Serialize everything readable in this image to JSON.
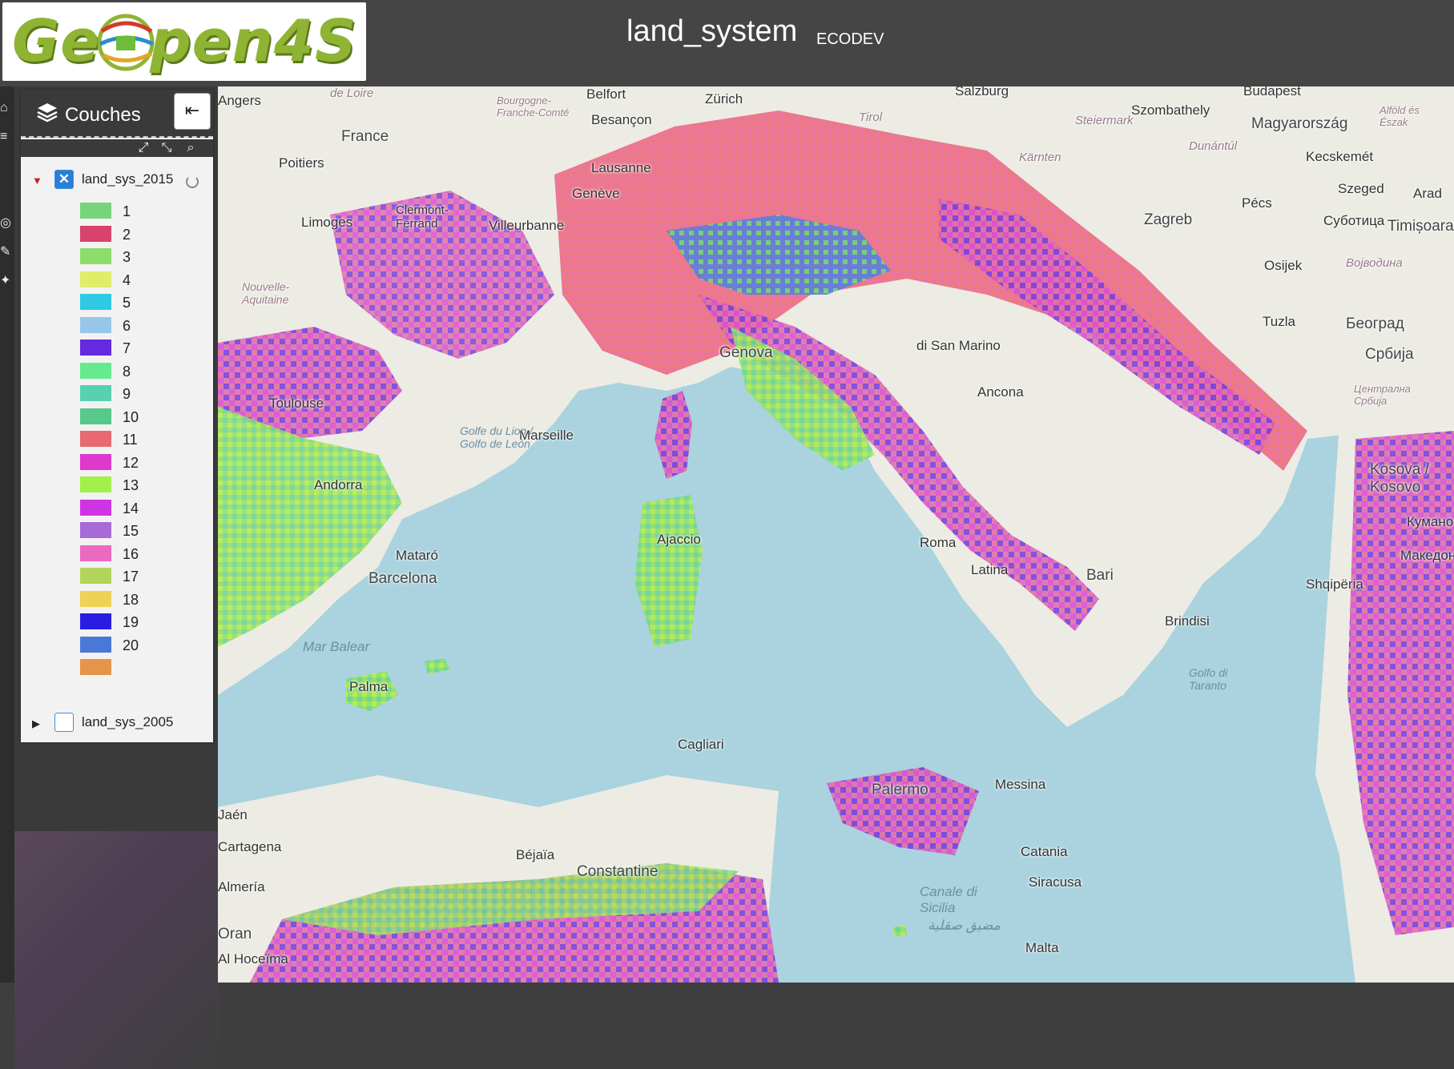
{
  "header": {
    "logo_text": "GeOpen4S",
    "title": "land_system",
    "subtitle": "ECODEV"
  },
  "toolbar": {
    "icons": [
      "home-icon",
      "layers-icon",
      "target-icon",
      "edit-icon",
      "pin-icon"
    ]
  },
  "panel": {
    "title": "Couches",
    "collapse_icon": "arrow-left-icon",
    "tools": [
      "expand-icon",
      "collapse-icon",
      "zoom-icon"
    ],
    "layers": [
      {
        "name": "land_sys_2015",
        "checked": true,
        "expanded": true,
        "loading": true,
        "legend": [
          {
            "label": "1",
            "color": "#77d579"
          },
          {
            "label": "2",
            "color": "#d8436b"
          },
          {
            "label": "3",
            "color": "#8edd6a"
          },
          {
            "label": "4",
            "color": "#e0ed6b"
          },
          {
            "label": "5",
            "color": "#30c9e3"
          },
          {
            "label": "6",
            "color": "#96c6ea"
          },
          {
            "label": "7",
            "color": "#6429e0"
          },
          {
            "label": "8",
            "color": "#66ea8f"
          },
          {
            "label": "9",
            "color": "#58d0b2"
          },
          {
            "label": "10",
            "color": "#56c98b"
          },
          {
            "label": "11",
            "color": "#e86a70"
          },
          {
            "label": "12",
            "color": "#dd39cd"
          },
          {
            "label": "13",
            "color": "#a4f04a"
          },
          {
            "label": "14",
            "color": "#cf34e3"
          },
          {
            "label": "15",
            "color": "#a86ad9"
          },
          {
            "label": "16",
            "color": "#ea6ac0"
          },
          {
            "label": "17",
            "color": "#b3d45a"
          },
          {
            "label": "18",
            "color": "#efd155"
          },
          {
            "label": "19",
            "color": "#2a1de2"
          },
          {
            "label": "20",
            "color": "#4a78d8"
          },
          {
            "label": "",
            "color": "#e5944a"
          }
        ]
      },
      {
        "name": "land_sys_2005",
        "checked": false,
        "expanded": false,
        "loading": false
      }
    ]
  },
  "map": {
    "labels": [
      "Angers",
      "de Loire",
      "Bourgogne-Franche-Comté",
      "Zürich",
      "Belfort",
      "Salzburg",
      "Budapest",
      "Szombathely",
      "Magyarország",
      "Alföld és Észak",
      "France",
      "Poitiers",
      "Besançon",
      "Steiermark",
      "Tirol",
      "Dunántúl",
      "Kecskemét",
      "Lausanne",
      "Genève",
      "Limoges",
      "Clermont-Ferrand",
      "Villeurbanne",
      "Kärnten",
      "Pécs",
      "Szeged",
      "Arad",
      "Суботица",
      "Timișoara",
      "Zagreb",
      "Osijek",
      "Војводина",
      "Nouvelle-Aquitaine",
      "Genova",
      "di San Marino",
      "Ancona",
      "Tuzla",
      "Београд",
      "Србија",
      "Toulouse",
      "Marseille",
      "Golfe du Lion / Golfo de León",
      "Централна Србија",
      "Andorra",
      "Mataró",
      "Barcelona",
      "Ajaccio",
      "Roma",
      "Bari",
      "Brindisi",
      "Latina",
      "Mar Balear",
      "Palma",
      "Golfo di Taranto",
      "Cagliari",
      "Palermo",
      "Messina",
      "Catania",
      "Siracusa",
      "Canale di Sicilia",
      "مضيق صقلية",
      "Malta",
      "Béjaïa",
      "Constantine",
      "Cartagena",
      "Jaén",
      "Almería",
      "Oran",
      "Al Hoceïma",
      "Kosova / Kosovo",
      "Shqipëria",
      "Кумано",
      "Македонија"
    ]
  }
}
